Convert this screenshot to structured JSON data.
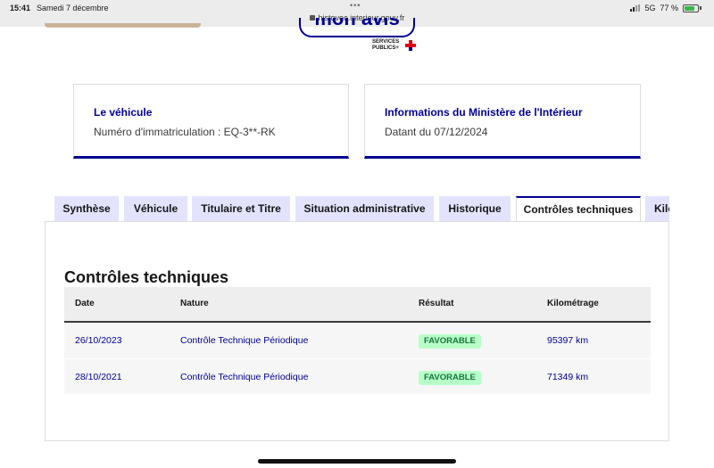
{
  "statusbar": {
    "time": "15:41",
    "date": "Samedi 7 décembre",
    "url": "histovec.interieur.gouv.fr",
    "network": "5G",
    "battery": "77 %"
  },
  "header": {
    "avis_button": "mon avis",
    "logo_text_1": "SERVICES",
    "logo_text_2": "PUBLICS+"
  },
  "cards": {
    "vehicle": {
      "title": "Le véhicule",
      "value": "Numéro d'immatriculation : EQ-3**-RK"
    },
    "ministry": {
      "title": "Informations du Ministère de l'Intérieur",
      "value": "Datant du 07/12/2024"
    }
  },
  "tabs": [
    {
      "label": "Synthèse"
    },
    {
      "label": "Véhicule"
    },
    {
      "label": "Titulaire et Titre"
    },
    {
      "label": "Situation administrative"
    },
    {
      "label": "Historique"
    },
    {
      "label": "Contrôles techniques",
      "active": true
    },
    {
      "label": "Kilométrage"
    }
  ],
  "section": {
    "title": "Contrôles techniques",
    "columns": [
      "Date",
      "Nature",
      "Résultat",
      "Kilométrage"
    ],
    "rows": [
      {
        "date": "26/10/2023",
        "nature": "Contrôle Technique Périodique",
        "result": "FAVORABLE",
        "km": "95397 km"
      },
      {
        "date": "28/10/2021",
        "nature": "Contrôle Technique Périodique",
        "result": "FAVORABLE",
        "km": "71349 km"
      }
    ]
  },
  "colors": {
    "brand_blue": "#000091",
    "tab_bg": "#e3e3fd",
    "badge_bg": "#b8fec9",
    "badge_text": "#18753c",
    "marianne_red": "#e1000f"
  }
}
